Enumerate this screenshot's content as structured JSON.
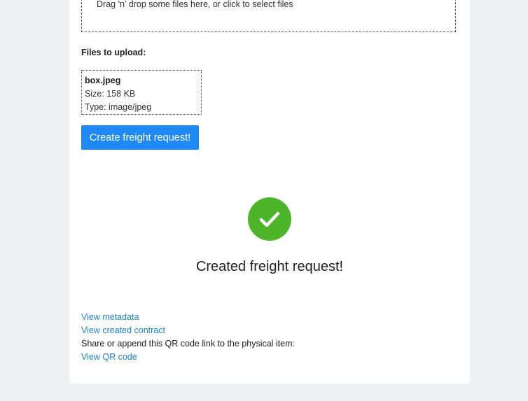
{
  "dropzone": {
    "text": "Drag 'n' drop some files here, or click to select files"
  },
  "files": {
    "heading": "Files to upload:",
    "items": [
      {
        "name": "box.jpeg",
        "size": "Size: 158 KB",
        "type": "Type: image/jpeg"
      }
    ]
  },
  "actions": {
    "create_label": "Create freight request!"
  },
  "status": {
    "icon": "check-circle-icon",
    "color": "#4cb52a",
    "title": "Created freight request!"
  },
  "links": {
    "metadata": "View metadata",
    "contract": "View created contract",
    "share_text": "Share or append this QR code link to the physical item:",
    "qr": "View QR code"
  },
  "theme": {
    "accent": "#1e88f5",
    "link": "#1a7fd6",
    "background": "#eef0f3"
  }
}
